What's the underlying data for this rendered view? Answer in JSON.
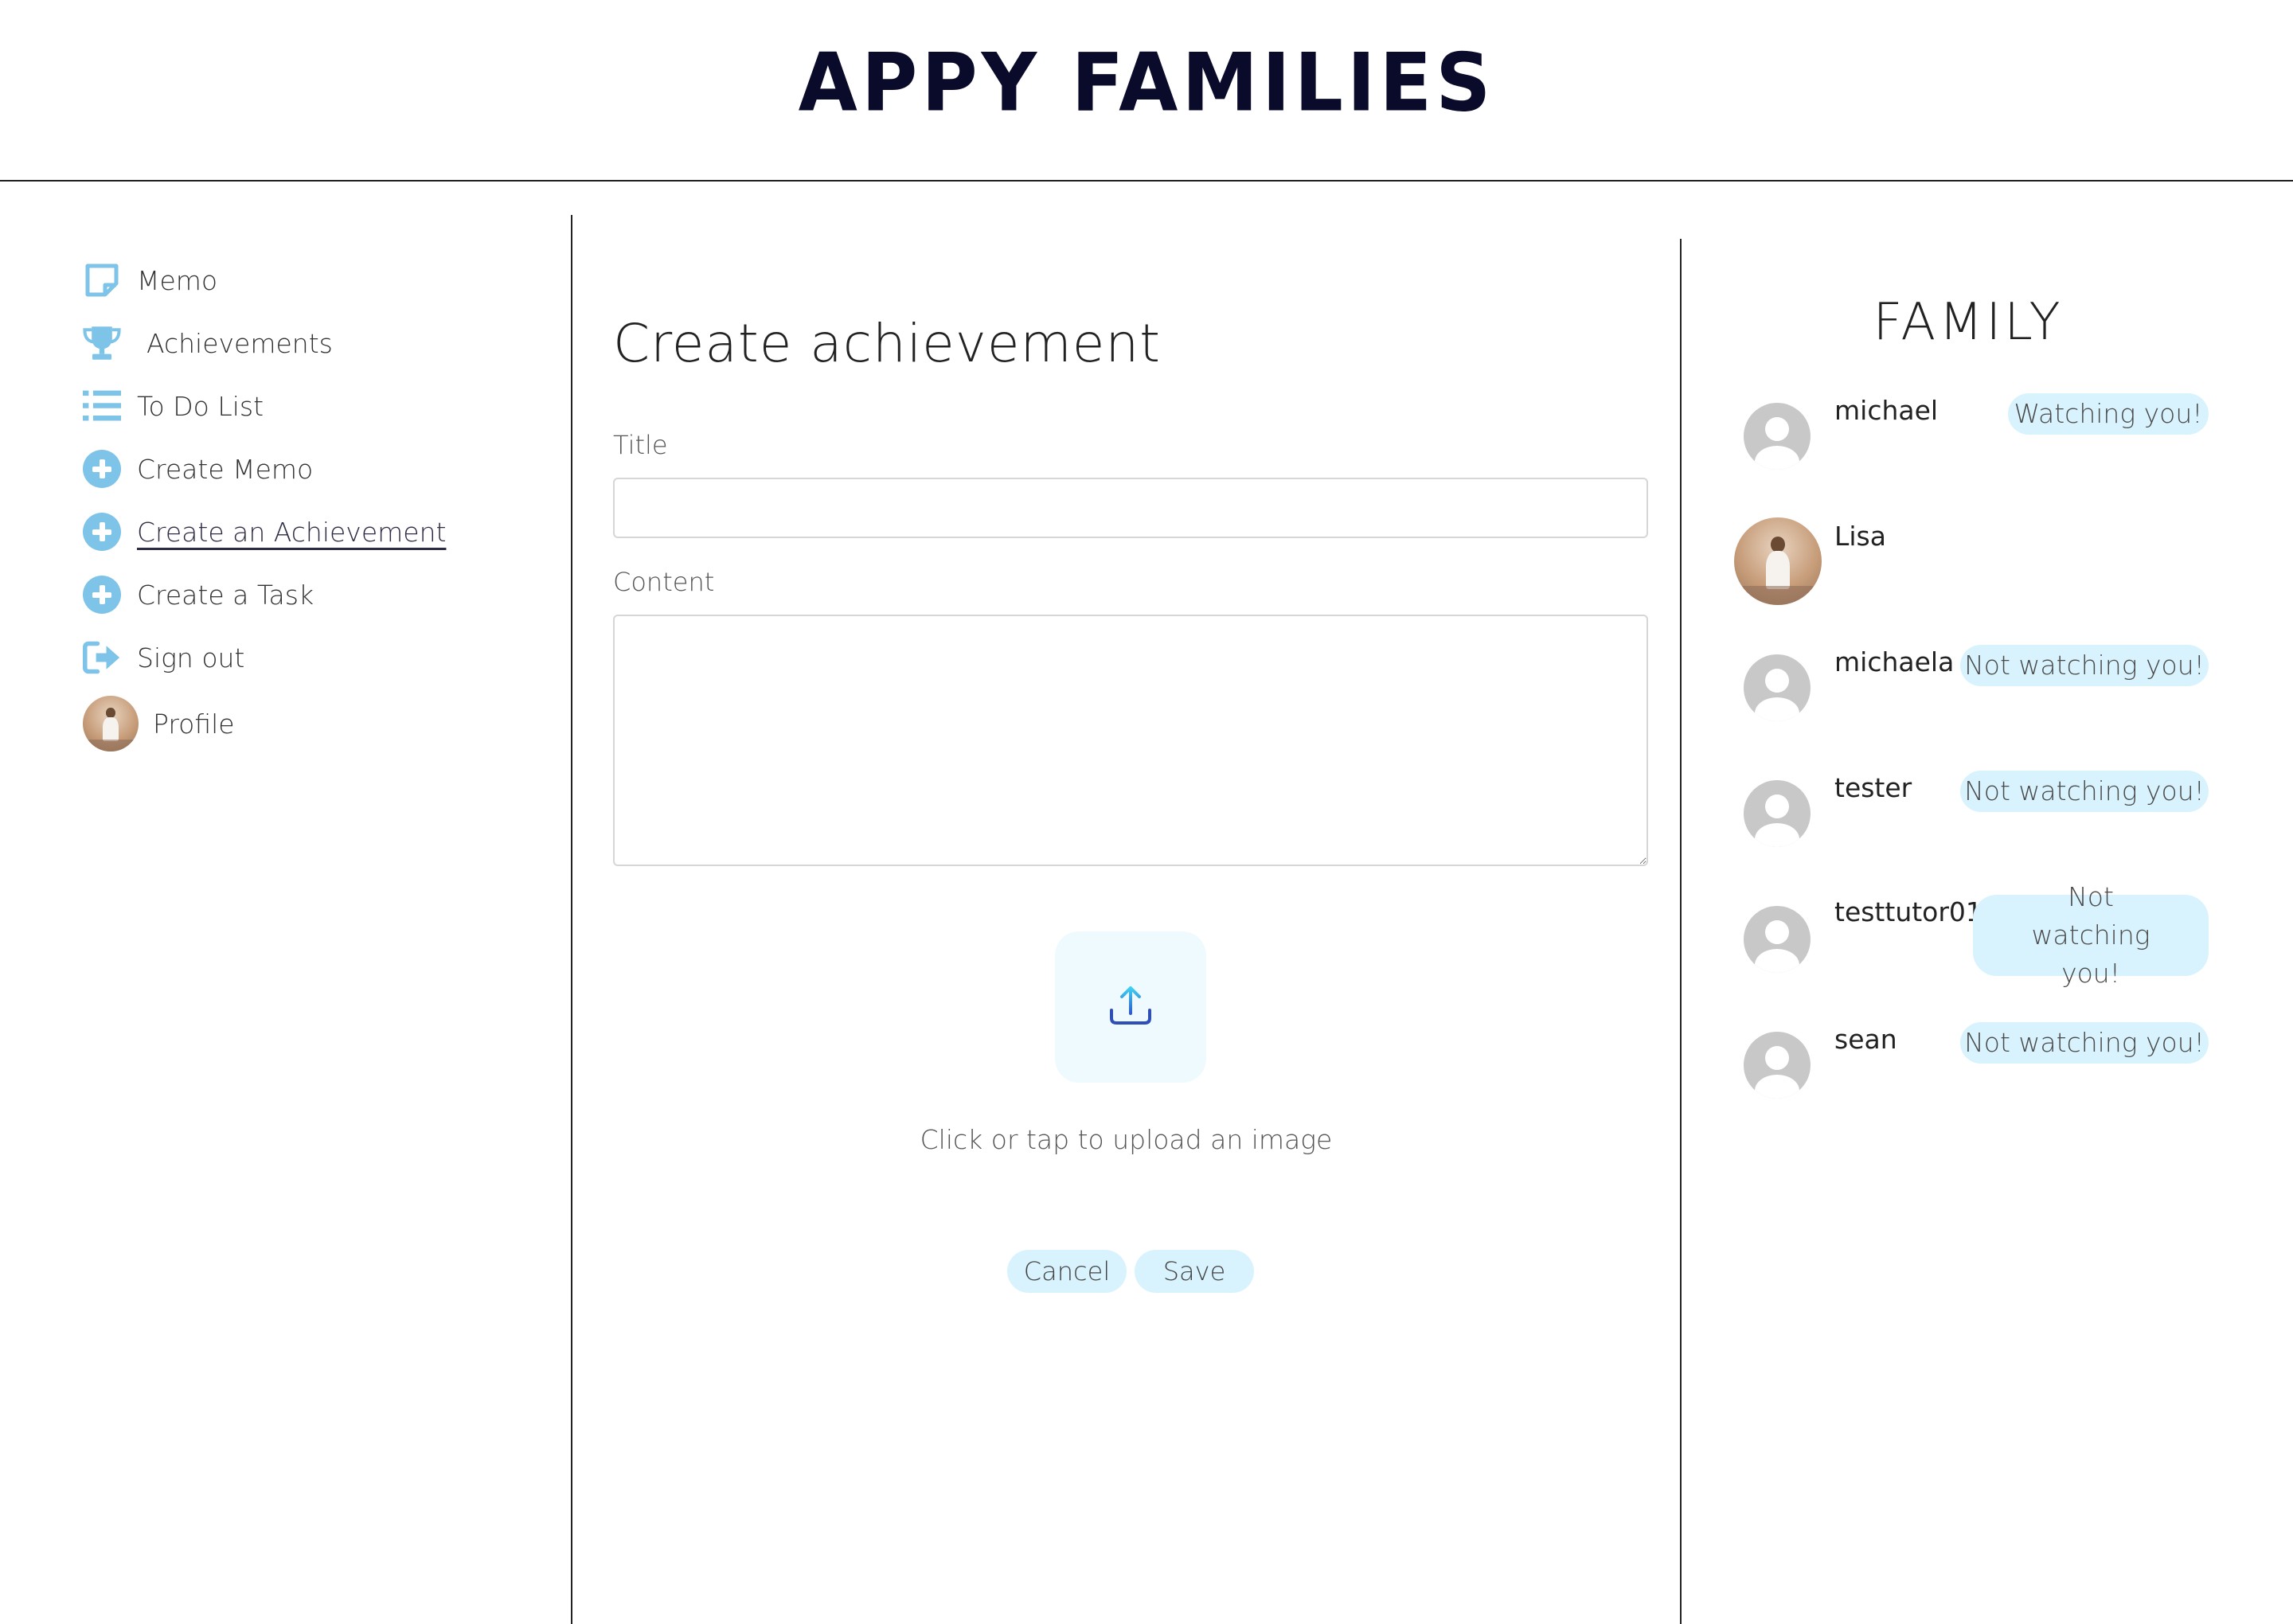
{
  "header": {
    "brand": "APPY FAMILIES"
  },
  "sidebar": {
    "items": [
      {
        "label": "Memo",
        "icon": "memo-icon"
      },
      {
        "label": "Achievements",
        "icon": "trophy-icon"
      },
      {
        "label": "To Do List",
        "icon": "list-icon"
      },
      {
        "label": "Create Memo",
        "icon": "plus-circle-icon"
      },
      {
        "label": "Create an Achievement",
        "icon": "plus-circle-icon",
        "active": true
      },
      {
        "label": "Create a Task",
        "icon": "plus-circle-icon"
      },
      {
        "label": "Sign out",
        "icon": "sign-out-icon"
      },
      {
        "label": "Profile",
        "icon": "avatar"
      }
    ]
  },
  "main": {
    "title": "Create achievement",
    "title_label": "Title",
    "title_value": "",
    "content_label": "Content",
    "content_value": "",
    "upload_text": "Click or tap to upload an image",
    "cancel_label": "Cancel",
    "save_label": "Save"
  },
  "family": {
    "heading": "FAMILY",
    "members": [
      {
        "name": "michael",
        "status": "Watching you!"
      },
      {
        "name": "Lisa",
        "status": ""
      },
      {
        "name": "michaela",
        "status": "Not watching you!"
      },
      {
        "name": "tester",
        "status": "Not watching you!"
      },
      {
        "name": "testtutor01",
        "status": "Not watching you!"
      },
      {
        "name": "sean",
        "status": "Not watching you!"
      }
    ]
  },
  "colors": {
    "accent": "#7ec3e8",
    "pill": "#d8f3fd",
    "brand": "#0a0a2a"
  }
}
